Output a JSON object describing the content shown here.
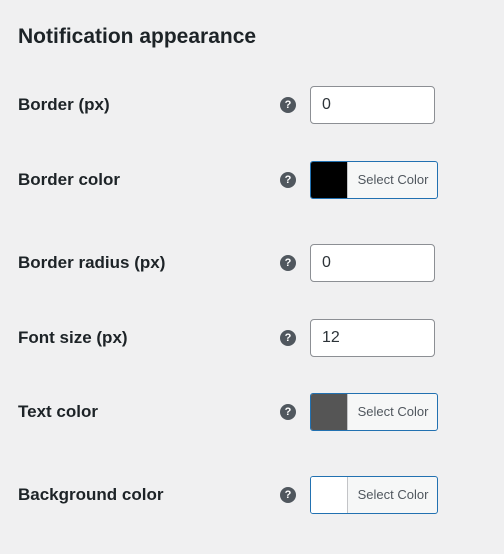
{
  "section": {
    "title": "Notification appearance"
  },
  "help_icon": {
    "glyph": "?",
    "icon": "question-circle-icon",
    "background": "#50575e"
  },
  "fields": {
    "border": {
      "label": "Border (px)",
      "value": "0"
    },
    "border_color": {
      "label": "Border color",
      "button_label": "Select Color",
      "swatch_color": "#000000"
    },
    "border_radius": {
      "label": "Border radius (px)",
      "value": "0"
    },
    "font_size": {
      "label": "Font size (px)",
      "value": "12"
    },
    "text_color": {
      "label": "Text color",
      "button_label": "Select Color",
      "swatch_color": "#555555"
    },
    "background_color": {
      "label": "Background color",
      "button_label": "Select Color",
      "swatch_color": "#ffffff"
    }
  },
  "colors": {
    "page_background": "#f0f0f1",
    "accent_border": "#2271b1",
    "input_border": "#8c8f94",
    "text": "#1d2327"
  }
}
